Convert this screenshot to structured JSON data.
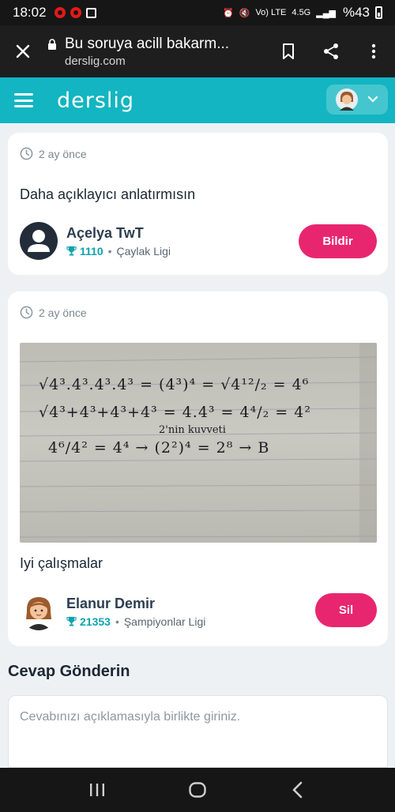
{
  "status_bar": {
    "time": "18:02",
    "network": "Vo) LTE",
    "network_type": "4.5G",
    "battery": "%43"
  },
  "browser": {
    "title": "Bu soruya acill bakarm...",
    "domain": "derslig.com"
  },
  "app": {
    "logo": "derslig"
  },
  "answers": [
    {
      "time": "2 ay önce",
      "text": "Daha açıklayıcı anlatırmısın",
      "author": {
        "name": "Açelya TwT",
        "points": "1110",
        "league": "Çaylak Ligi"
      },
      "action": "Bildir"
    },
    {
      "time": "2 ay önce",
      "photo": {
        "lines": [
          "√4³.4³.4³.4³ = (4³)⁴ = √4¹²/₂ = 4⁶",
          "√4³+4³+4³+4³ = 4.4³ = 4⁴/₂ = 4²",
          "4⁶/4² = 4⁴ → (2²)⁴ = 2⁸ → B"
        ],
        "note": "2'nin kuvveti"
      },
      "text": "Iyi çalışmalar",
      "author": {
        "name": "Elanur Demir",
        "points": "21353",
        "league": "Şampiyonlar Ligi"
      },
      "action": "Sil"
    }
  ],
  "reply": {
    "title": "Cevap Gönderin",
    "placeholder": "Cevabınızı açıklamasıyla birlikte giriniz."
  },
  "colors": {
    "brand": "#12b5c1",
    "accent": "#e8266f",
    "points": "#0fa3ad"
  }
}
